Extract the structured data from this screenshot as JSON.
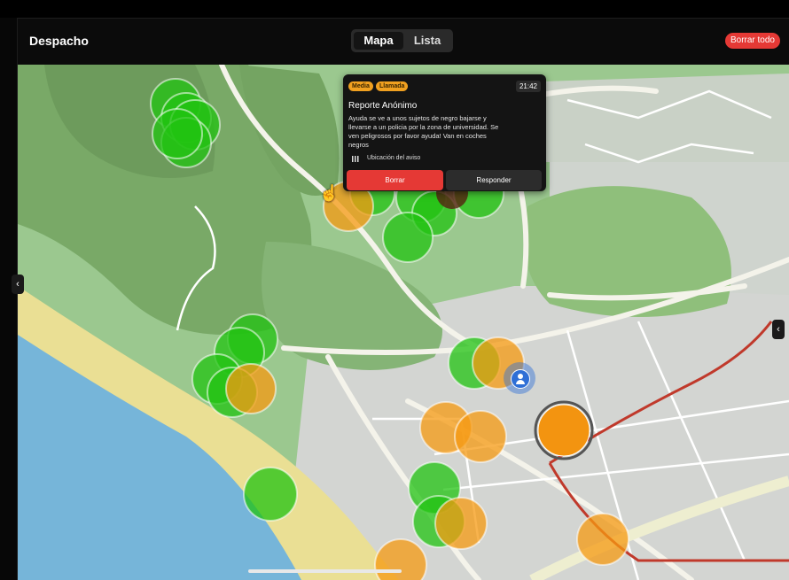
{
  "header": {
    "title": "Despacho",
    "tabs": [
      {
        "label": "Mapa",
        "active": true
      },
      {
        "label": "Lista",
        "active": false
      }
    ],
    "clear_all_label": "Borrar todo"
  },
  "popup": {
    "badges": [
      "Media",
      "Llamada"
    ],
    "time": "21:42",
    "title": "Reporte Anónimo",
    "body": "Ayuda se ve a unos sujetos de negro bajarse y llevarse a un policia por la zona de universidad. Se ven peligrosos por favor ayuda! Van en coches negros",
    "location_label": "Ubicación del aviso",
    "delete_label": "Borrar",
    "reply_label": "Responder"
  },
  "icons": {
    "left_collapse": "chevron-left-icon",
    "right_collapse": "chevron-left-icon",
    "user_marker": "user-icon",
    "location": "location-icon",
    "cursor": "hand-cursor-icon"
  },
  "colors": {
    "green_marker": "#22c311",
    "orange_marker": "#f59a12",
    "clear_button": "#e53935",
    "user_marker": "#2f6fd6"
  }
}
